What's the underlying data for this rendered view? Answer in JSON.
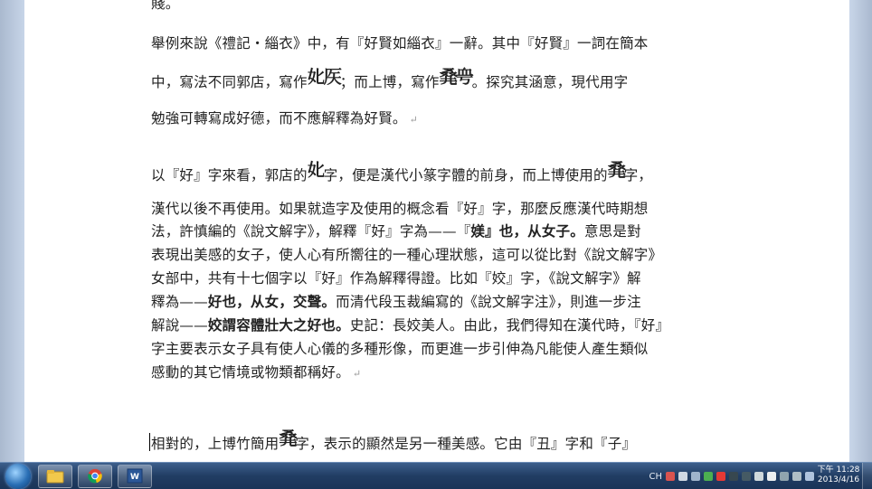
{
  "document": {
    "top_fragment": "賤。",
    "p1": {
      "l1": "舉例來說《禮記‧緇衣》中，有『好賢如緇衣』一辭。其中『好賢』一詞在簡本",
      "l2a": "中，寫法不同郭店，寫作",
      "glyph_guodian": "𡚧",
      "glyph_guodian_b": "𥎦",
      "l2b": "；而上博，寫作",
      "glyph_shangbo": "𠭌",
      "glyph_shangbo_b": "𧖨",
      "l2c": "。探究其涵意，現代用字",
      "l3": "勉強可轉寫成好德，而不應解釋為好賢。"
    },
    "p2": {
      "l1a": "以『好』字來看，郭店的",
      "l1b": "字，便是漢代小篆字體的前身，而上博使用的",
      "l1c": "字，",
      "l2": "漢代以後不再使用。如果就造字及使用的概念看『好』字，那麼反應漢代時期想",
      "l3a": "法，許慎編的《說文解字》，解釋『好』字為——『",
      "l3b": "媄』也，从女子。",
      "l3c": "意思是對",
      "l4": "表現出美感的女子，使人心有所嚮往的一種心理狀態，這可以從比對《說文解字》",
      "l5": "女部中，共有十七個字以『好』作為解釋得證。比如『姣』字，《說文解字》解",
      "l6a": "釋為——",
      "l6b": "好也，从女，交聲。",
      "l6c": "而清代段玉裁編寫的《說文解字注》，則進一步注",
      "l7a": "解說——",
      "l7b": "姣謂容體壯大之好也。",
      "l7c": "史記：長姣美人。由此，我們得知在漢代時，『好』",
      "l8": "字主要表示女子具有使人心儀的多種形像，而更進一步引伸為凡能使人產生類似",
      "l9": "感動的其它情境或物類都稱好。"
    },
    "p3": {
      "l1a": "相對的，上博竹簡用",
      "l1b": "字，表示的顯然是另一種美感。它由『丑』字和『子』"
    }
  },
  "taskbar": {
    "tray_lang": "CH",
    "clock_time": "下午 11:28",
    "clock_date": "2013/4/16"
  },
  "icons": [
    "start-orb-icon",
    "folder-icon",
    "chrome-icon",
    "word-icon"
  ]
}
